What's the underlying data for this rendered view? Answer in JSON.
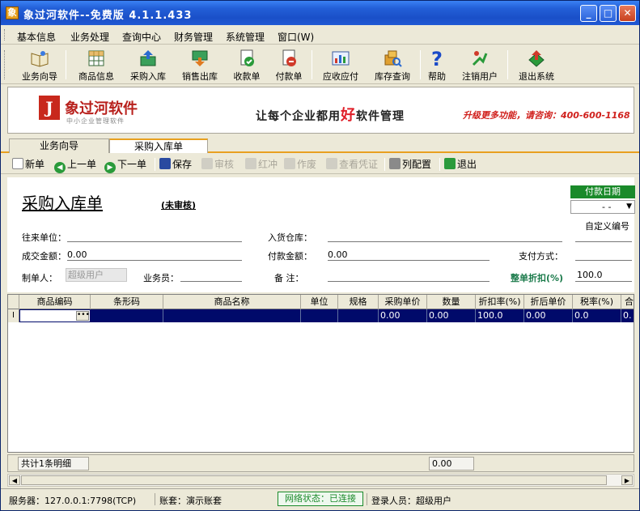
{
  "window": {
    "title": "象过河软件--免费版  4.1.1.433"
  },
  "menu": [
    "基本信息",
    "业务处理",
    "查询中心",
    "财务管理",
    "系统管理",
    "窗口(W)"
  ],
  "toolbar": [
    "业务向导",
    "商品信息",
    "采购入库",
    "销售出库",
    "收款单",
    "付款单",
    "应收应付",
    "库存查询",
    "帮助",
    "注销用户",
    "退出系统"
  ],
  "banner": {
    "brand": "象过河软件",
    "brand_sub": "中小企业管理软件",
    "slogan_pre": "让每个企业都用",
    "slogan_hl": "好",
    "slogan_post": "软件管理",
    "contact": "升级更多功能，请咨询：400-600-1168"
  },
  "tabs": [
    "业务向导",
    "采购入库单"
  ],
  "subbar": [
    "新单",
    "上一单",
    "下一单",
    "保存",
    "审核",
    "红冲",
    "作废",
    "查看凭证",
    "列配置",
    "退出"
  ],
  "form": {
    "doc_title": "采购入库单",
    "status": "(未审核)",
    "paydate_btn": "付款日期",
    "paydate_value": "- -",
    "custom_no": "自定义编号",
    "supplier_label": "往来单位：",
    "warehouse_label": "入货仓库：",
    "deal_amount_label": "成交金额：",
    "deal_amount_value": "0.00",
    "pay_amount_label": "付款金额：",
    "pay_amount_value": "0.00",
    "pay_method_label": "支付方式：",
    "creator_label": "制单人：",
    "creator_value": "超级用户",
    "salesman_label": "业务员：",
    "remark_label": "备    注：",
    "discount_label": "整单折扣(%)",
    "discount_value": "100.0"
  },
  "grid": {
    "headers": [
      "商品编码",
      "条形码",
      "商品名称",
      "单位",
      "规格",
      "采购单价",
      "数量",
      "折扣率(%)",
      "折后单价",
      "税率(%)",
      "合"
    ],
    "row": [
      "",
      "",
      "",
      "",
      "",
      "0.00",
      "0.00",
      "100.0",
      "0.00",
      "0.0",
      "0."
    ],
    "row_marker": "I",
    "count_text": "共计1条明细",
    "total_qty": "0.00"
  },
  "statusbar": {
    "server": "服务器：127.0.0.1:7798(TCP)",
    "account": "账套：演示账套",
    "network": "网络状态：已连接",
    "user": "登录人员：超级用户"
  }
}
